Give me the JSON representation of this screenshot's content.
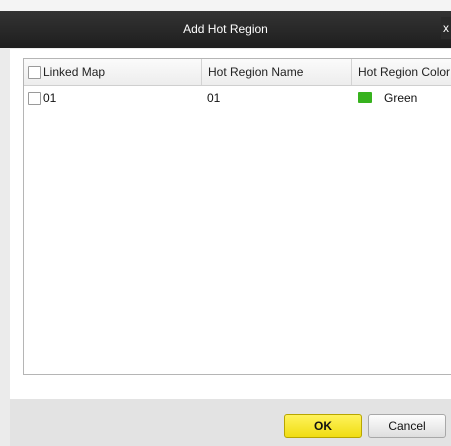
{
  "dialog": {
    "title": "Add Hot Region",
    "close_label": "x"
  },
  "table": {
    "columns": [
      "Linked Map",
      "Hot Region Name",
      "Hot Region Color"
    ],
    "rows": [
      {
        "linked_map": "01",
        "name": "01",
        "color_label": "Green",
        "color": "#37b21e",
        "checked": false
      }
    ]
  },
  "buttons": {
    "ok": "OK",
    "cancel": "Cancel"
  },
  "colors": {
    "titlebar": "#2b2b2b",
    "ok_button": "#f5e830",
    "green_swatch": "#37b21e"
  }
}
